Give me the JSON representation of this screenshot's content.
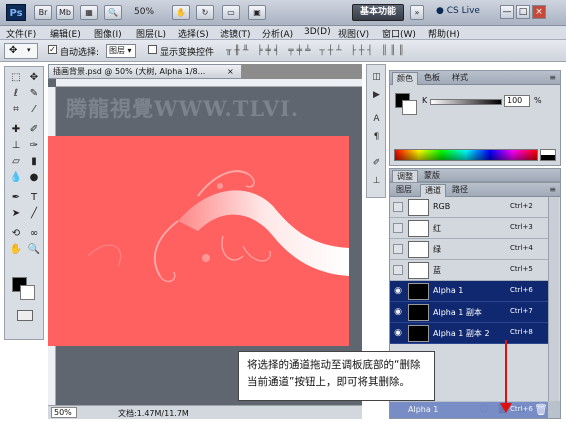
{
  "titlebar": {
    "app_logo": "Ps",
    "buttons": [
      "Br",
      "Mb"
    ],
    "zoom": "50%",
    "workspace": "基本功能",
    "cs_live": "CS Live",
    "window_controls": [
      "—",
      "□",
      "×"
    ]
  },
  "menu": [
    "文件(F)",
    "编辑(E)",
    "图像(I)",
    "图层(L)",
    "选择(S)",
    "滤镜(T)",
    "分析(A)",
    "3D(D)",
    "视图(V)",
    "窗口(W)",
    "帮助(H)"
  ],
  "options": {
    "auto_select_label": "自动选择:",
    "auto_select_value": "图层",
    "show_transform_label": "显示变换控件"
  },
  "document": {
    "tab_title": "插画背景.psd @ 50% (大树, Alpha 1/8...",
    "tab_close": "×",
    "watermark": "腾龍視覺WWW.TLVI.",
    "zoom_field": "50%",
    "doc_info": "文档:1.47M/11.7M"
  },
  "color_panel": {
    "tabs": [
      "颜色",
      "色板",
      "样式"
    ],
    "k_label": "K",
    "k_value": "100",
    "k_unit": "%"
  },
  "adjust_tabs": [
    "调整",
    "蒙版"
  ],
  "channels_panel": {
    "tabs": [
      "图层",
      "通道",
      "路径"
    ],
    "channels": [
      {
        "name": "RGB",
        "shortcut": "Ctrl+2",
        "selected": false
      },
      {
        "name": "红",
        "shortcut": "Ctrl+3",
        "selected": false
      },
      {
        "name": "绿",
        "shortcut": "Ctrl+4",
        "selected": false
      },
      {
        "name": "蓝",
        "shortcut": "Ctrl+5",
        "selected": false
      },
      {
        "name": "Alpha 1",
        "shortcut": "Ctrl+6",
        "selected": true
      },
      {
        "name": "Alpha 1 副本",
        "shortcut": "Ctrl+7",
        "selected": true
      },
      {
        "name": "Alpha 1 副本 2",
        "shortcut": "Ctrl+8",
        "selected": true
      }
    ],
    "drag_row_name": "Alpha 1",
    "drag_row_shortcut": "Ctrl+6"
  },
  "callout": {
    "text": "将选择的通道拖动至调板底部的“删除当前通道”按钮上，即可将其删除。"
  },
  "colors": {
    "canvas": "#ff6060",
    "selected_row": "#102870",
    "arrow": "#e01010"
  }
}
